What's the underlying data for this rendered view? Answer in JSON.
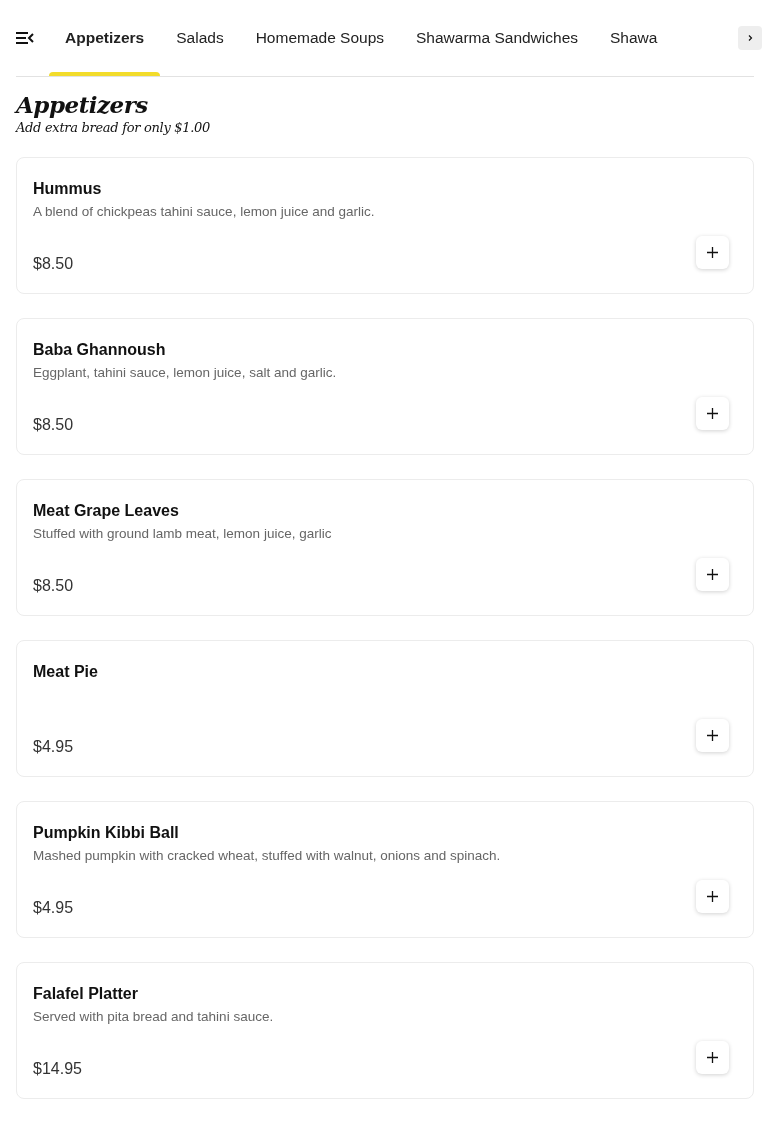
{
  "tabs": [
    {
      "label": "Appetizers",
      "selected": true
    },
    {
      "label": "Salads",
      "selected": false
    },
    {
      "label": "Homemade Soups",
      "selected": false
    },
    {
      "label": "Shawarma Sandwiches",
      "selected": false
    },
    {
      "label": "Shawa",
      "selected": false
    }
  ],
  "section": {
    "title": "Appetizers",
    "subtitle": "Add extra bread for only $1.00"
  },
  "items": [
    {
      "name": "Hummus",
      "description": "A blend of chickpeas tahini sauce, lemon juice and garlic.",
      "price": "$8.50"
    },
    {
      "name": "Baba Ghannoush",
      "description": "Eggplant, tahini sauce, lemon juice, salt and garlic.",
      "price": "$8.50"
    },
    {
      "name": "Meat Grape Leaves",
      "description": "Stuffed with ground lamb meat, lemon juice, garlic",
      "price": "$8.50"
    },
    {
      "name": "Meat Pie",
      "price": "$4.95"
    },
    {
      "name": "Pumpkin Kibbi Ball",
      "description": "Mashed pumpkin with cracked wheat, stuffed with walnut, onions and spinach.",
      "price": "$4.95"
    },
    {
      "name": "Falafel Platter",
      "description": "Served with pita bread and tahini sauce.",
      "price": "$14.95"
    }
  ]
}
